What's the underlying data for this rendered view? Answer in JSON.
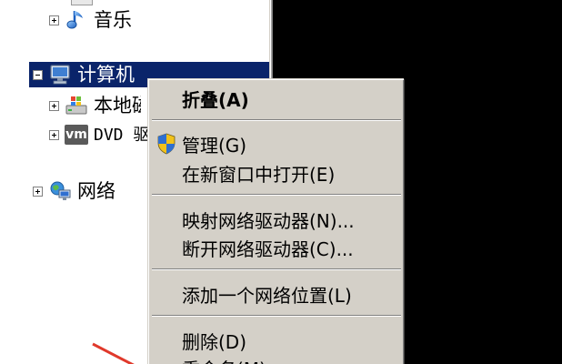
{
  "tree": {
    "items": [
      {
        "label": "音乐",
        "icon": "music-note-icon",
        "expander": "plus"
      },
      {
        "label": "计算机",
        "icon": "computer-icon",
        "expander": "minus",
        "selected": true
      },
      {
        "label": "本地磁盘",
        "icon": "local-disk-icon",
        "expander": "plus"
      },
      {
        "label": "DVD 驱动器",
        "icon": "vm-dvd-icon",
        "expander": "plus"
      },
      {
        "label": "网络",
        "icon": "network-icon",
        "expander": "plus"
      }
    ],
    "vm_badge": "vm"
  },
  "context_menu": {
    "items": [
      {
        "label": "折叠(A)",
        "bold": true
      },
      {
        "label": "管理(G)",
        "icon": "uac-shield-icon"
      },
      {
        "label": "在新窗口中打开(E)"
      },
      {
        "label": "映射网络驱动器(N)..."
      },
      {
        "label": "断开网络驱动器(C)..."
      },
      {
        "label": "添加一个网络位置(L)"
      },
      {
        "label": "删除(D)"
      },
      {
        "label": "重命名(M)"
      }
    ]
  },
  "colors": {
    "selection": "#0a246a",
    "menu_bg": "#d4d0c8",
    "arrow": "#e0392b"
  }
}
